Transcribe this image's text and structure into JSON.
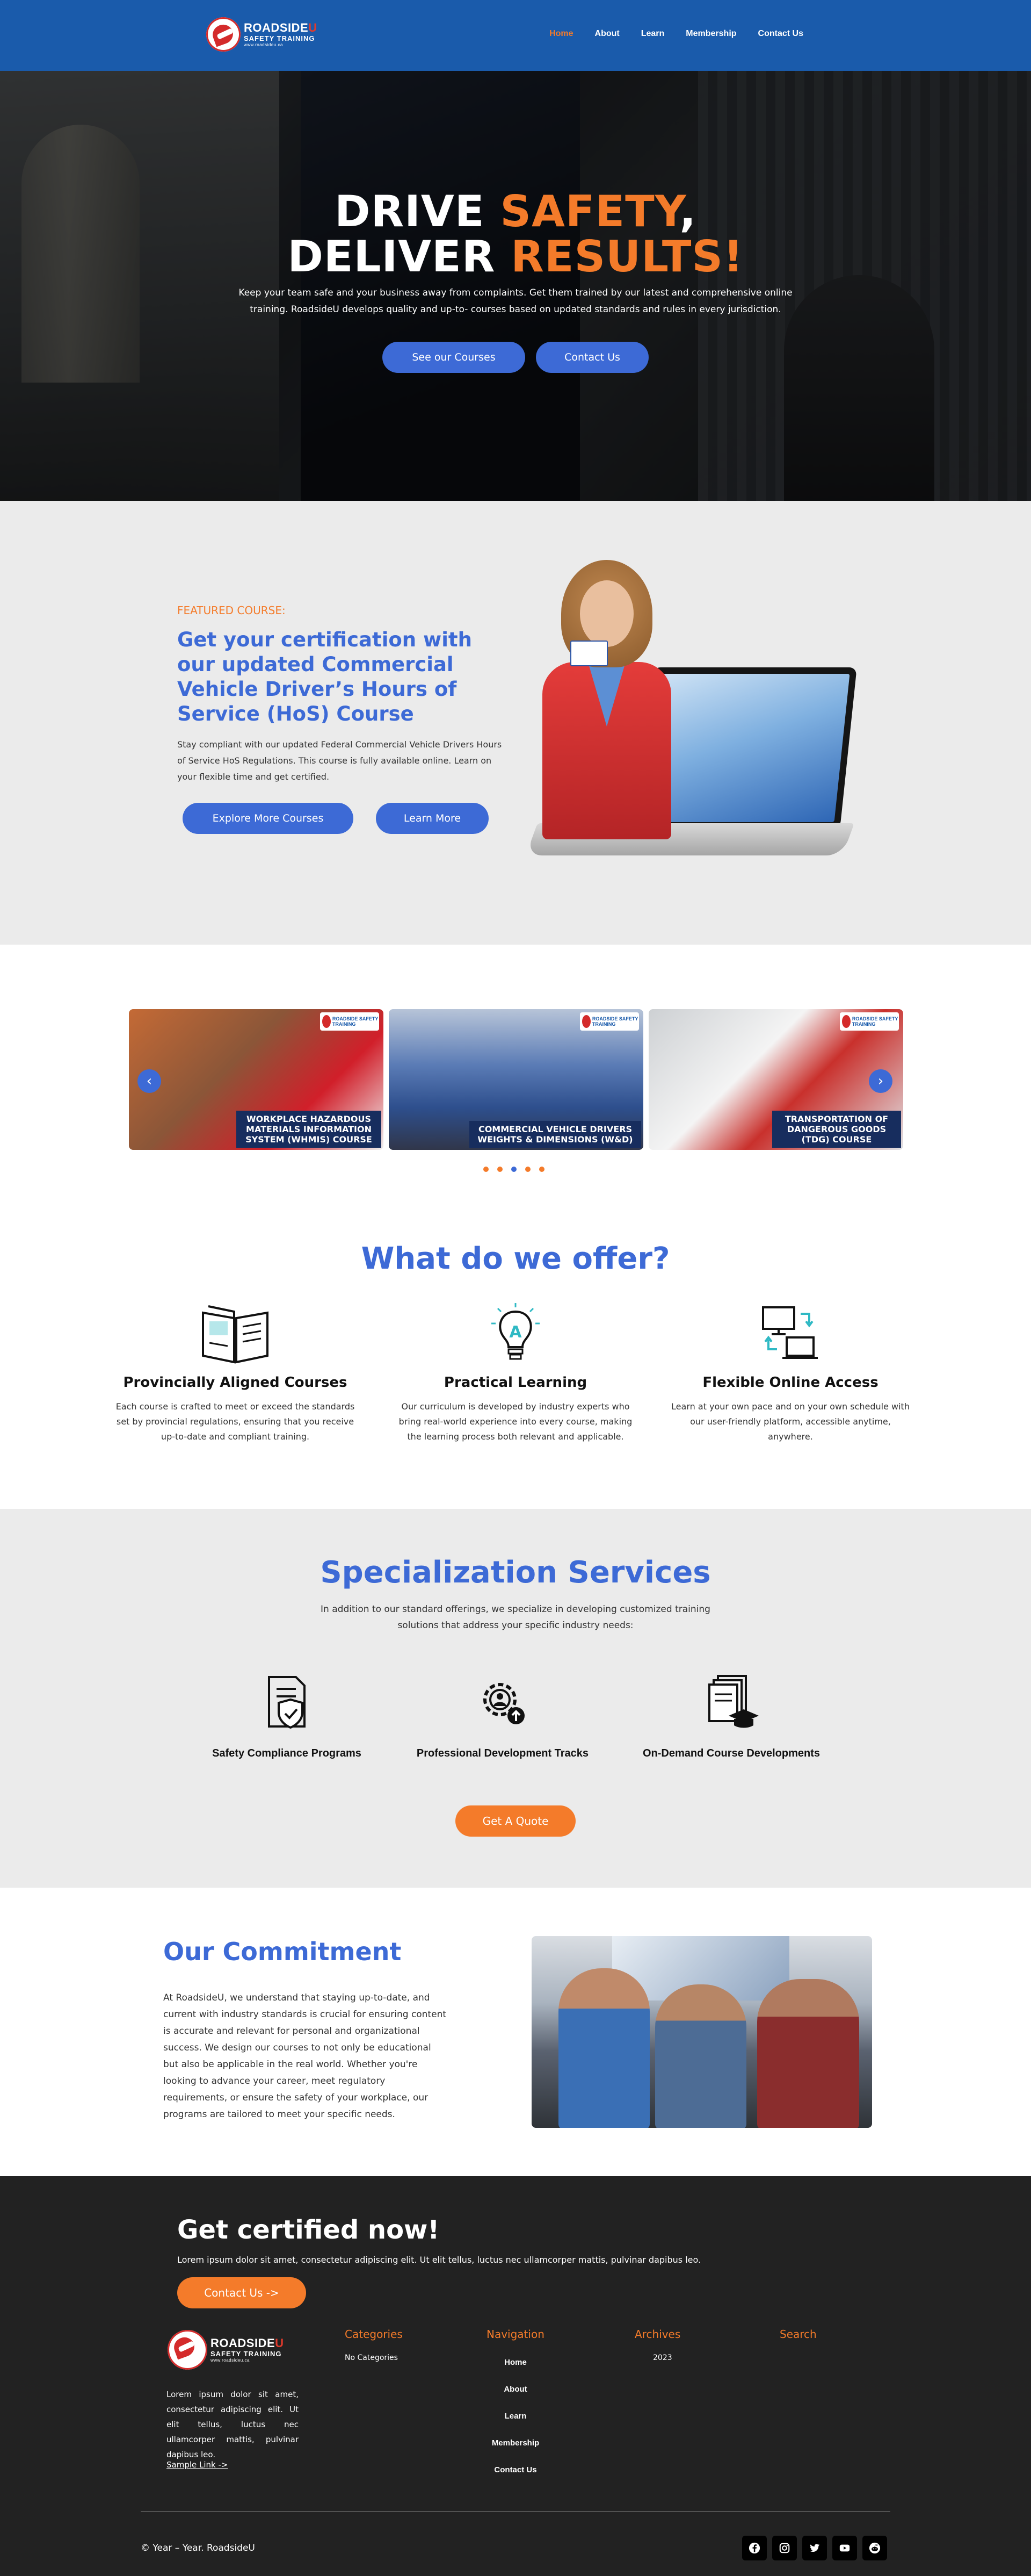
{
  "brand": {
    "line1": "ROADSIDE",
    "line1_accent": "U",
    "line2": "SAFETY TRAINING",
    "line3": "www.roadsideu.ca"
  },
  "nav": {
    "items": [
      "Home",
      "About",
      "Learn",
      "Membership",
      "Contact Us"
    ],
    "active": "Home"
  },
  "hero": {
    "title_line1_white": "DRIVE ",
    "title_line1_orange": "SAFETY",
    "title_line1_end": ",",
    "title_line2_white": "DELIVER ",
    "title_line2_orange": "RESULTS!",
    "subtitle": "Keep your team safe and your business away from complaints. Get them trained by our latest and comprehensive online training. RoadsideU develops quality and up-to- courses based on updated standards and rules in every jurisdiction.",
    "btn_courses": "See our Courses",
    "btn_contact": "Contact Us"
  },
  "featured": {
    "label": "FEATURED COURSE:",
    "title": "Get your certification with our updated Commercial Vehicle Driver’s Hours of Service (HoS) Course",
    "text": "Stay compliant with our updated Federal Commercial Vehicle Drivers Hours of Service HoS Regulations. This course is fully available online. Learn on your flexible time and get certified.",
    "btn_explore": "Explore More Courses",
    "btn_learn": "Learn More"
  },
  "carousel": {
    "slides": [
      {
        "caption": "WORKPLACE HAZARDOUS MATERIALS INFORMATION SYSTEM (WHMIS) COURSE"
      },
      {
        "caption": "COMMERCIAL VEHICLE DRIVERS WEIGHTS & DIMENSIONS (W&D)"
      },
      {
        "caption": "TRANSPORTATION OF DANGEROUS GOODS (TDG) COURSE"
      }
    ],
    "mini_logo": "ROADSIDE SAFETY TRAINING",
    "prev": "‹",
    "next": "›",
    "dot_count": 5,
    "active_dot": 2
  },
  "offer": {
    "title": "What do we offer?",
    "items": [
      {
        "title": "Provincially Aligned Courses",
        "text": "Each course is crafted to meet or exceed the standards set by provincial regulations, ensuring that you receive up-to-date and compliant training.",
        "icon": "book-icon"
      },
      {
        "title": "Practical Learning",
        "text": "Our curriculum is developed by industry experts who bring real-world experience into every course, making the learning process both relevant and applicable.",
        "icon": "lightbulb-icon"
      },
      {
        "title": "Flexible Online Access",
        "text": "Learn at your own pace and on your own schedule with our user-friendly platform, accessible anytime, anywhere.",
        "icon": "devices-sync-icon"
      }
    ]
  },
  "spec": {
    "title": "Specialization Services",
    "text": "In addition to our standard offerings, we specialize in developing customized training solutions that address your specific industry needs:",
    "items": [
      {
        "title": "Safety Compliance Programs",
        "icon": "shield-document-icon"
      },
      {
        "title": "Professional Development Tracks",
        "icon": "gear-user-icon"
      },
      {
        "title": "On-Demand Course Developments",
        "icon": "graduation-documents-icon"
      }
    ],
    "btn": "Get A Quote"
  },
  "commitment": {
    "title": "Our Commitment",
    "text": "At RoadsideU, we understand that staying up-to-date, and current with industry standards is crucial for ensuring content is accurate and relevant for personal and organizational success. We design our courses to not only be educational but also be applicable in the real world. Whether you're looking to advance your career, meet regulatory requirements, or ensure the safety of your workplace, our programs are tailored to meet your specific needs."
  },
  "footer": {
    "cta_title": "Get certified now!",
    "cta_text": "Lorem ipsum dolor sit amet, consectetur adipiscing elit. Ut elit tellus, luctus nec ullamcorper mattis, pulvinar dapibus leo.",
    "cta_btn": "Contact Us ->",
    "about": "Lorem ipsum dolor sit amet, consectetur adipiscing elit. Ut elit tellus, luctus nec ullamcorper mattis, pulvinar dapibus leo.",
    "sample_link": "Sample Link ->",
    "categories_title": "Categories",
    "categories_empty": "No Categories",
    "navigation_title": "Navigation",
    "navigation_items": [
      "Home",
      "About",
      "Learn",
      "Membership",
      "Contact Us"
    ],
    "archives_title": "Archives",
    "archives_items": [
      "2023"
    ],
    "search_title": "Search",
    "copyright": "© Year – Year. RoadsideU",
    "socials": [
      "facebook-icon",
      "instagram-icon",
      "twitter-icon",
      "youtube-icon",
      "reddit-icon"
    ]
  },
  "colors": {
    "header_blue": "#1a5bab",
    "accent_blue": "#3d6ad6",
    "accent_orange": "#f47b2a",
    "footer_bg": "#222222"
  }
}
